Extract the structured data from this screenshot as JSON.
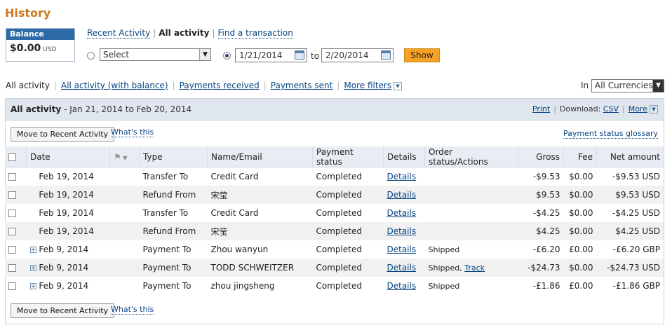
{
  "page": {
    "title": "History"
  },
  "balance": {
    "label": "Balance",
    "amount": "$0.00",
    "currency": "USD"
  },
  "view_links": {
    "recent": "Recent Activity",
    "all": "All activity",
    "find": "Find a transaction"
  },
  "search": {
    "select_value": "Select",
    "date_from": "1/21/2014",
    "to_label": "to",
    "date_to": "2/20/2014",
    "show_label": "Show"
  },
  "filters": {
    "all": "All activity",
    "all_balance": "All activity (with balance)",
    "received": "Payments received",
    "sent": "Payments sent",
    "more": "More filters",
    "in_label": "In",
    "currency_value": "All Currencies"
  },
  "panel": {
    "title": "All activity",
    "range": "- Jan 21, 2014 to Feb 20, 2014",
    "print": "Print",
    "download_label": "Download:",
    "csv": "CSV",
    "more": "More",
    "move_btn": "Move to Recent Activity",
    "whats_this": "What's this",
    "glossary": "Payment status glossary"
  },
  "table": {
    "headers": {
      "date": "Date",
      "type": "Type",
      "name": "Name/Email",
      "status": "Payment status",
      "details": "Details",
      "order": "Order status/Actions",
      "gross": "Gross",
      "fee": "Fee",
      "net": "Net amount"
    },
    "rows": [
      {
        "date": "Feb 19, 2014",
        "type": "Transfer To",
        "name": "Credit Card",
        "status": "Completed",
        "details": "Details",
        "order": "",
        "track": "",
        "gross": "-$9.53",
        "fee": "$0.00",
        "net": "-$9.53 USD",
        "expand": false
      },
      {
        "date": "Feb 19, 2014",
        "type": "Refund From",
        "name": "宋莹",
        "status": "Completed",
        "details": "Details",
        "order": "",
        "track": "",
        "gross": "$9.53",
        "fee": "$0.00",
        "net": "$9.53 USD",
        "expand": false
      },
      {
        "date": "Feb 19, 2014",
        "type": "Transfer To",
        "name": "Credit Card",
        "status": "Completed",
        "details": "Details",
        "order": "",
        "track": "",
        "gross": "-$4.25",
        "fee": "$0.00",
        "net": "-$4.25 USD",
        "expand": false
      },
      {
        "date": "Feb 19, 2014",
        "type": "Refund From",
        "name": "宋莹",
        "status": "Completed",
        "details": "Details",
        "order": "",
        "track": "",
        "gross": "$4.25",
        "fee": "$0.00",
        "net": "$4.25 USD",
        "expand": false
      },
      {
        "date": "Feb 9, 2014",
        "type": "Payment To",
        "name": "Zhou wanyun",
        "status": "Completed",
        "details": "Details",
        "order": "Shipped",
        "track": "",
        "gross": "-£6.20",
        "fee": "£0.00",
        "net": "-£6.20 GBP",
        "expand": true
      },
      {
        "date": "Feb 9, 2014",
        "type": "Payment To",
        "name": "TODD SCHWEITZER",
        "status": "Completed",
        "details": "Details",
        "order": "Shipped,",
        "track": "Track",
        "gross": "-$24.73",
        "fee": "$0.00",
        "net": "-$24.73 USD",
        "expand": true
      },
      {
        "date": "Feb 9, 2014",
        "type": "Payment To",
        "name": "zhou jingsheng",
        "status": "Completed",
        "details": "Details",
        "order": "Shipped",
        "track": "",
        "gross": "-£1.86",
        "fee": "£0.00",
        "net": "-£1.86 GBP",
        "expand": true
      }
    ]
  }
}
